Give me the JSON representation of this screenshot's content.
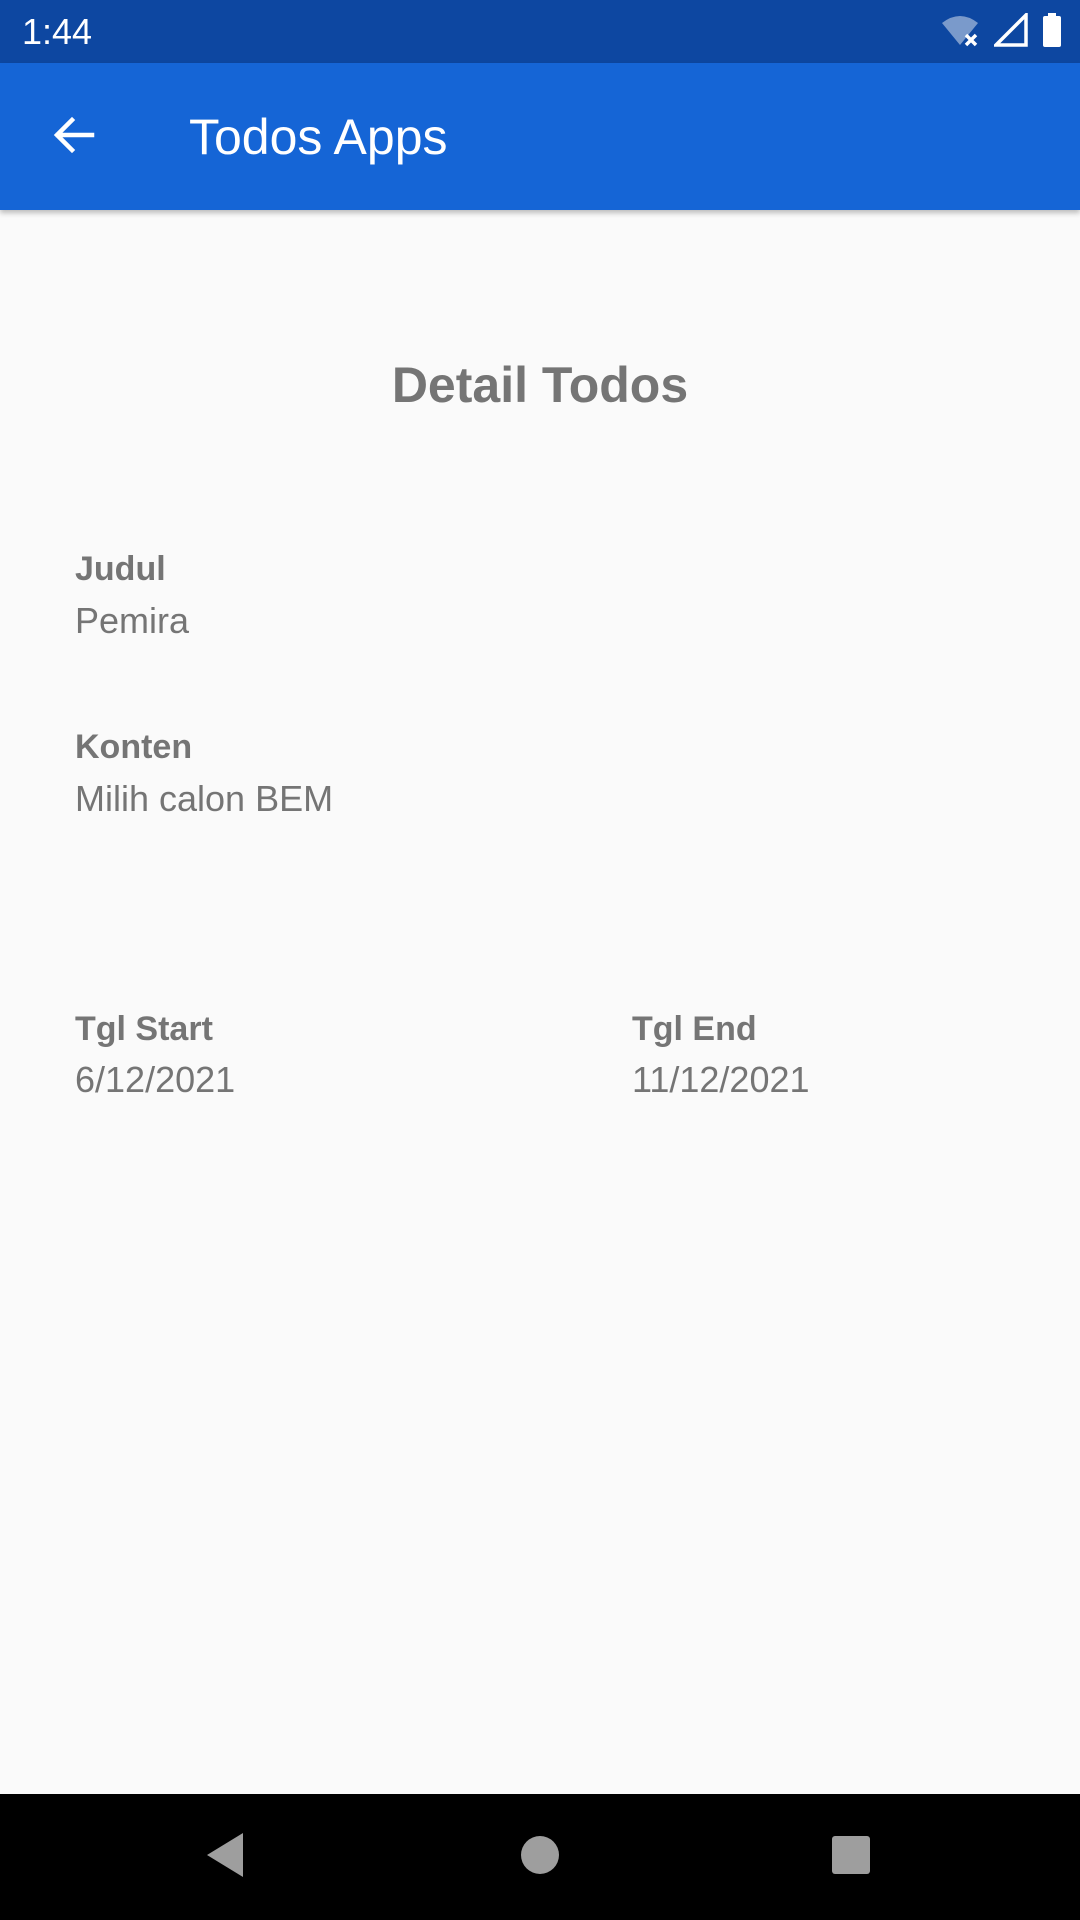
{
  "status_bar": {
    "time": "1:44",
    "icons": [
      "wifi-off-icon",
      "signal-icon",
      "battery-icon"
    ]
  },
  "app_bar": {
    "title": "Todos Apps",
    "back_icon": "arrow-back-icon",
    "color": "#1565d6",
    "status_color": "#0d47a1"
  },
  "detail": {
    "heading": "Detail Todos",
    "judul_label": "Judul",
    "judul_value": "Pemira",
    "konten_label": "Konten",
    "konten_value": "Milih calon BEM",
    "tgl_start_label": "Tgl Start",
    "tgl_start_value": "6/12/2021",
    "tgl_end_label": "Tgl End",
    "tgl_end_value": "11/12/2021",
    "text_color": "#757575"
  },
  "nav_bar": {
    "icons": [
      "back-triangle-icon",
      "home-circle-icon",
      "recents-square-icon"
    ]
  }
}
